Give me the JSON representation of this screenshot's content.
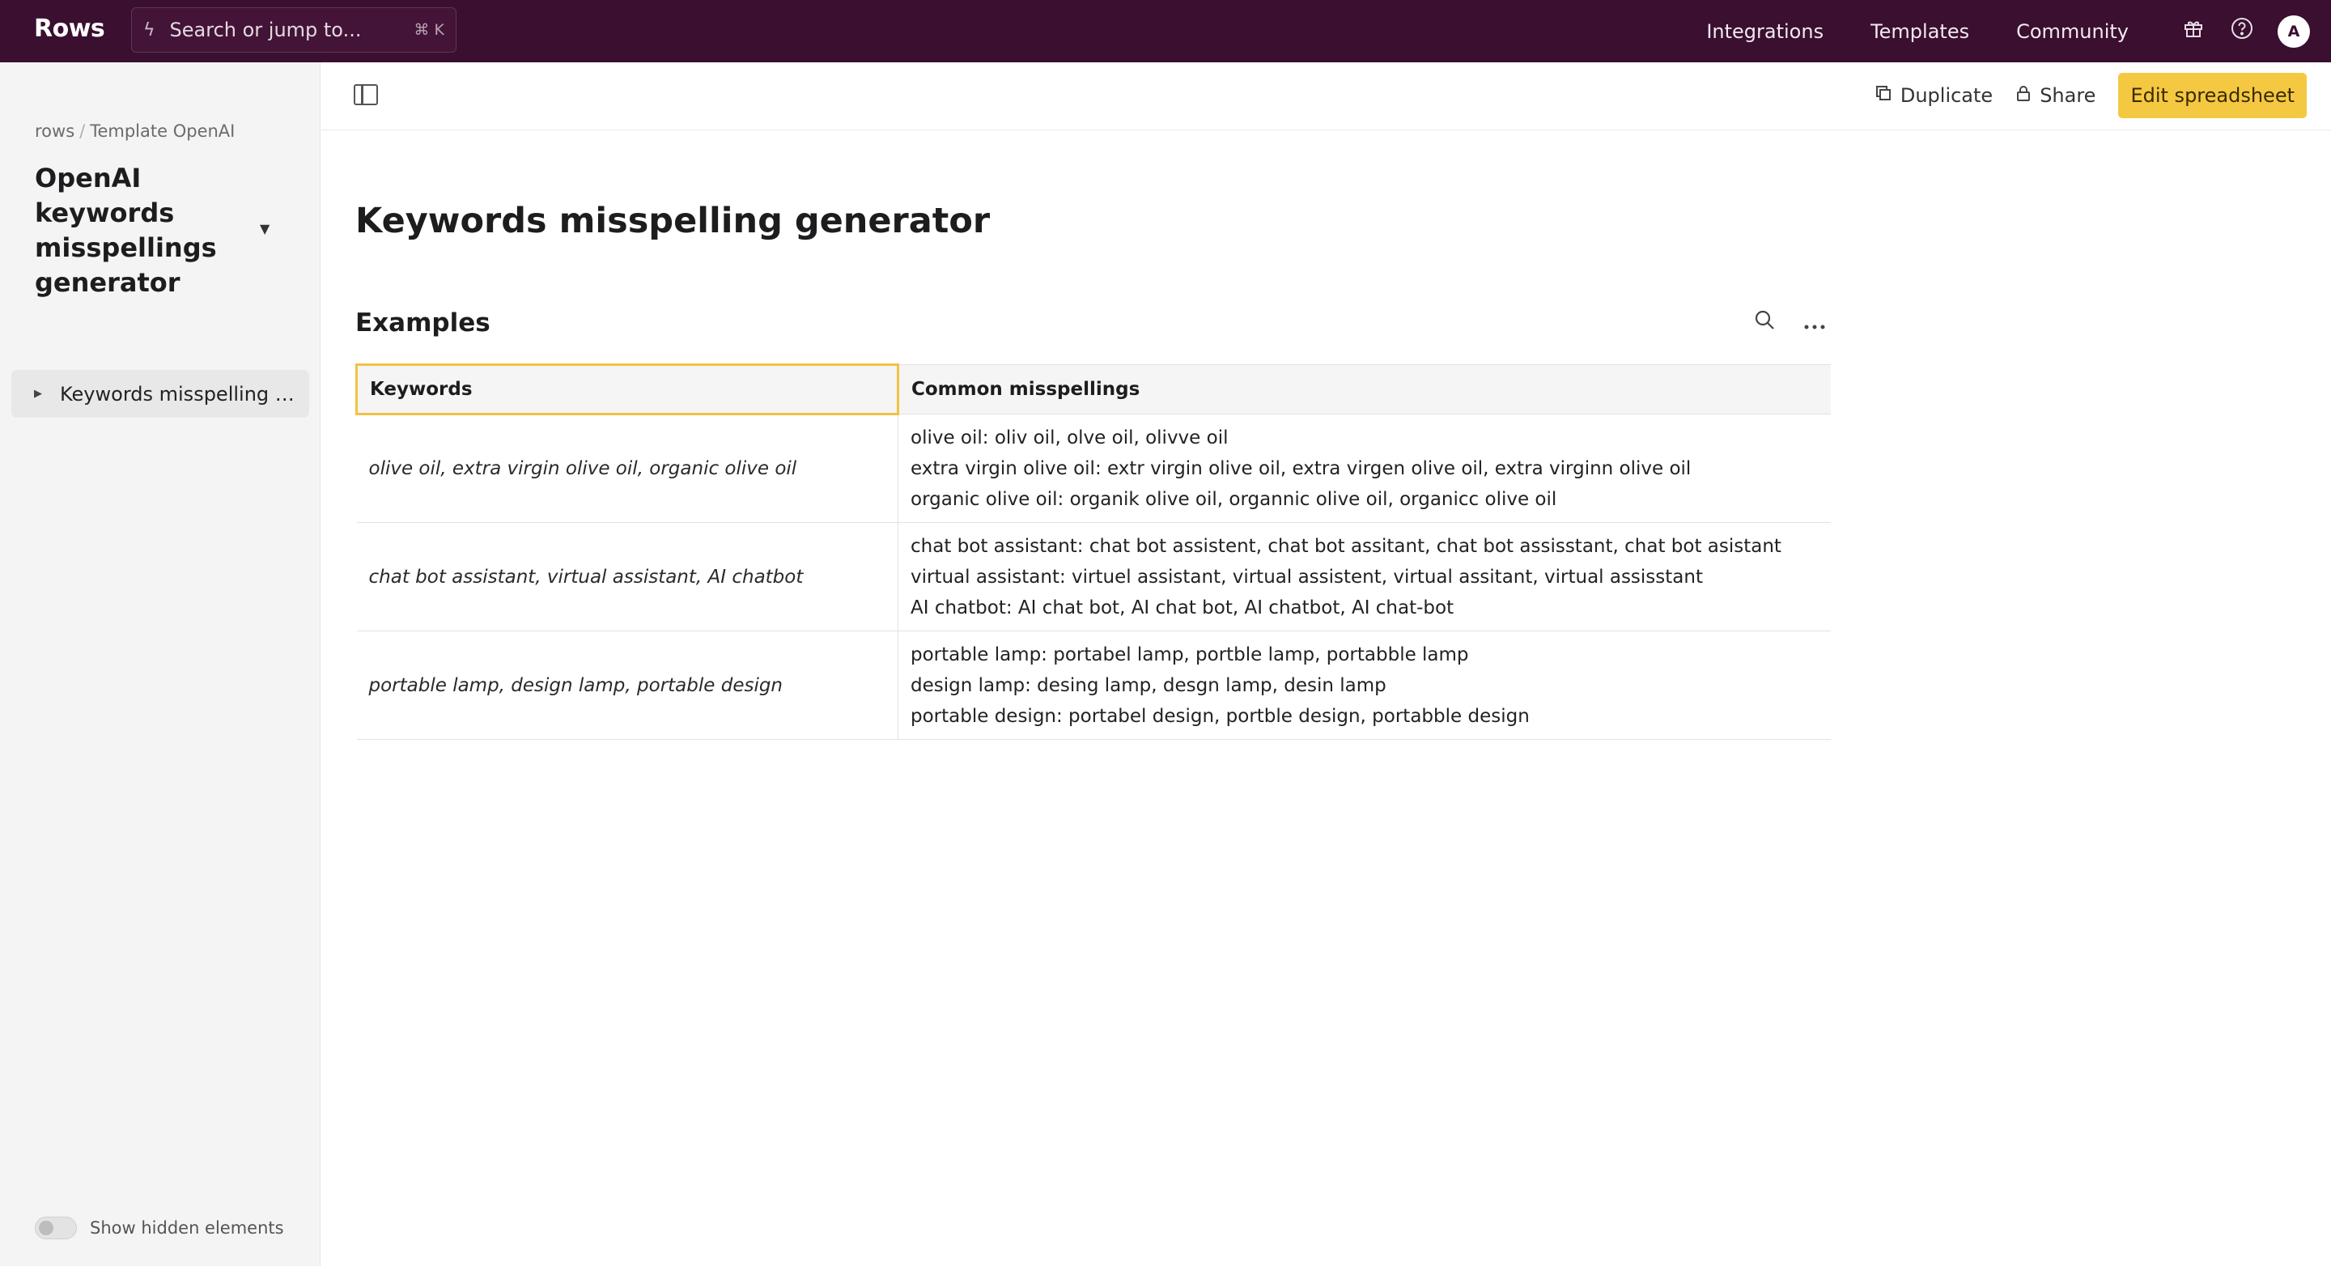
{
  "topbar": {
    "brand": "Rows",
    "search_placeholder": "Search or jump to...",
    "search_shortcut": "⌘ K",
    "nav": [
      "Integrations",
      "Templates",
      "Community"
    ],
    "avatar_initial": "A"
  },
  "sidebar": {
    "breadcrumb_root": "rows",
    "breadcrumb_current": "Template OpenAI",
    "doc_title": "OpenAI keywords misspellings generator",
    "items": [
      {
        "label": "Keywords misspelling generator"
      }
    ],
    "show_hidden_label": "Show hidden elements"
  },
  "toolbar": {
    "duplicate_label": "Duplicate",
    "share_label": "Share",
    "edit_label": "Edit spreadsheet"
  },
  "page": {
    "title": "Keywords misspelling generator",
    "section_title": "Examples"
  },
  "table": {
    "headers": [
      "Keywords",
      "Common misspellings"
    ],
    "rows": [
      {
        "keywords": "olive oil, extra virgin olive oil, organic olive oil",
        "misspellings": [
          "olive oil: oliv oil, olve oil, olivve oil",
          "extra virgin olive oil: extr virgin olive oil, extra virgen olive oil, extra virginn olive oil",
          "organic olive oil: organik olive oil, organnic olive oil, organicc olive oil"
        ]
      },
      {
        "keywords": "chat bot assistant, virtual assistant, AI chatbot",
        "misspellings": [
          "chat bot assistant: chat bot assistent, chat bot assitant, chat bot assisstant, chat bot asistant",
          "virtual assistant: virtuel assistant, virtual assistent, virtual assitant, virtual assisstant",
          "AI chatbot: AI chat bot, AI chat bot, AI chatbot, AI chat-bot"
        ]
      },
      {
        "keywords": "portable lamp, design lamp, portable design",
        "misspellings": [
          "portable lamp: portabel lamp, portble lamp, portabble lamp",
          "design lamp: desing lamp, desgn lamp, desin lamp",
          "portable design: portabel design, portble design, portabble design"
        ]
      }
    ]
  },
  "colors": {
    "topbar_bg": "#3a0f2f",
    "accent_yellow": "#f5c842",
    "sidebar_bg": "#f4f4f4"
  },
  "icons": [
    "bolt-icon",
    "gift-icon",
    "help-icon",
    "panel-toggle-icon",
    "duplicate-icon",
    "lock-icon",
    "search-icon",
    "more-icon",
    "caret-down-icon",
    "caret-right-icon"
  ]
}
